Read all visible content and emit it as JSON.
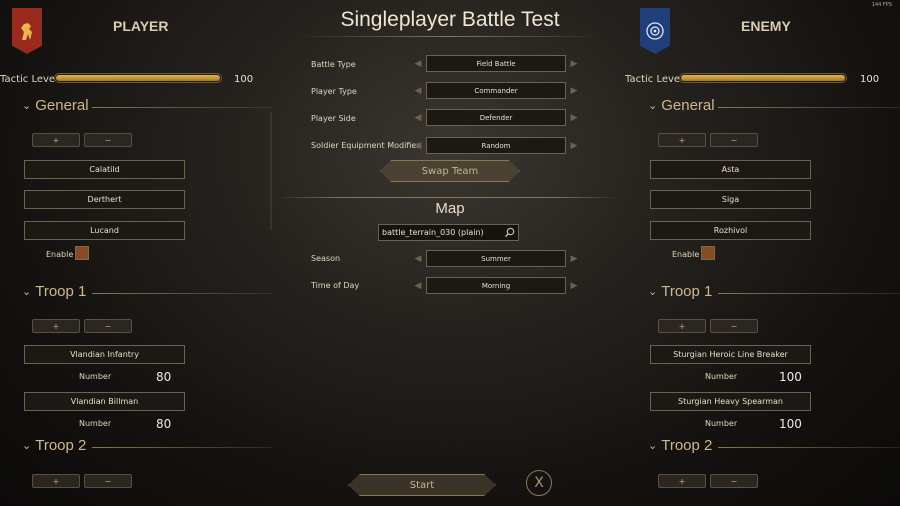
{
  "fps": "144 FPS",
  "title": "Singleplayer Battle Test",
  "player": {
    "title": "PLAYER",
    "tactic_label": "Tactic Level",
    "tactic_value": "100",
    "tactic_fraction": 1.0,
    "general_head": "General",
    "plus": "+",
    "minus": "−",
    "generals": [
      "Calatild",
      "Derthert",
      "Lucand"
    ],
    "enable_label": "Enable",
    "troop1_head": "Troop 1",
    "troop1_units": [
      {
        "name": "Vlandian Infantry",
        "number_label": "Number",
        "number": "80"
      },
      {
        "name": "Vlandian Billman",
        "number_label": "Number",
        "number": "80"
      }
    ],
    "troop2_head": "Troop 2"
  },
  "enemy": {
    "title": "ENEMY",
    "tactic_label": "Tactic Level",
    "tactic_value": "100",
    "tactic_fraction": 1.0,
    "general_head": "General",
    "plus": "+",
    "minus": "−",
    "generals": [
      "Asta",
      "Siga",
      "Rozhivol"
    ],
    "enable_label": "Enable",
    "troop1_head": "Troop 1",
    "troop1_units": [
      {
        "name": "Sturgian Heroic Line Breaker",
        "number_label": "Number",
        "number": "100"
      },
      {
        "name": "Sturgian Heavy Spearman",
        "number_label": "Number",
        "number": "100"
      }
    ],
    "troop2_head": "Troop 2"
  },
  "settings": {
    "battle_type": {
      "label": "Battle Type",
      "value": "Field Battle"
    },
    "player_type": {
      "label": "Player Type",
      "value": "Commander"
    },
    "player_side": {
      "label": "Player Side",
      "value": "Defender"
    },
    "equipment": {
      "label": "Soldier Equipment Modifier",
      "value": "Random"
    },
    "swap_label": "Swap Team"
  },
  "map": {
    "title": "Map",
    "terrain": "battle_terrain_030 (plain)",
    "season": {
      "label": "Season",
      "value": "Summer"
    },
    "time": {
      "label": "Time of Day",
      "value": "Morning"
    }
  },
  "start_label": "Start",
  "close_label": "X",
  "colors": {
    "accent_gold": "#c8a04a",
    "player_banner": "#9a2a1e",
    "enemy_banner": "#1f3e7a"
  }
}
